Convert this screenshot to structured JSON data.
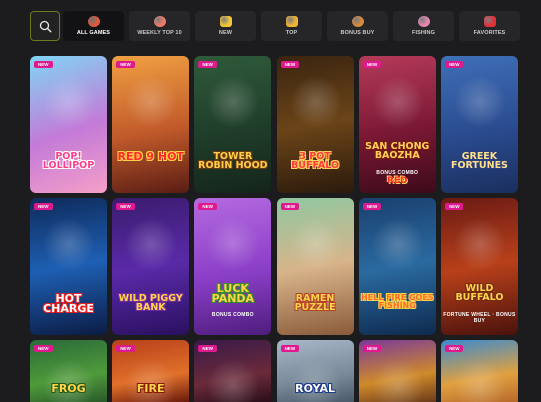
{
  "tabs": [
    {
      "label": "ALL GAMES",
      "icon": "slot-icon",
      "color": "#e0583a",
      "active": true
    },
    {
      "label": "WEEKLY TOP 10",
      "icon": "hot-icon",
      "color": "#f07a6a",
      "active": false
    },
    {
      "label": "NEW",
      "icon": "star-icon",
      "color": "#f4c534",
      "active": false
    },
    {
      "label": "TOP",
      "icon": "crown-icon",
      "color": "#f2b233",
      "active": false
    },
    {
      "label": "BONUS BUY",
      "icon": "money-bag-icon",
      "color": "#d98a3a",
      "active": false
    },
    {
      "label": "FISHING",
      "icon": "shell-icon",
      "color": "#e986b2",
      "active": false
    },
    {
      "label": "FAVORITES",
      "icon": "heart-icon",
      "color": "#e2303a",
      "active": false
    }
  ],
  "badge_label": "NEW",
  "games": [
    {
      "title": "POP! LOLLIPOP",
      "bg": "linear-gradient(160deg,#7fd6f4 0%,#c47ad8 55%,#f59fc8 100%)",
      "title_color": "#ff3e8a",
      "stroke": "#fff"
    },
    {
      "title": "RED 9 HOT",
      "bg": "linear-gradient(170deg,#f0a043 0%,#c15a2a 55%,#5a1d14 100%)",
      "title_color": "#ff2b2b",
      "stroke": "#ffd04a"
    },
    {
      "title": "TOWER ROBIN HOOD",
      "bg": "linear-gradient(170deg,#2f5a3a 0%,#1f3d2a 55%,#14251a 100%)",
      "title_color": "#ffcf48",
      "stroke": "#6a3a10"
    },
    {
      "title": "3 POT BUFFALO",
      "bg": "linear-gradient(170deg,#3a2410 0%,#6b4418 50%,#2b1a0c 100%)",
      "title_color": "#ff3b3b",
      "stroke": "#ffd35a"
    },
    {
      "title": "SAN CHONG BAOZHA",
      "subtitle": "BONUS COMBO",
      "extra": "RED",
      "bg": "linear-gradient(170deg,#b53a5a 0%,#7a1834 55%,#3c0a1a 100%)",
      "title_color": "#ffd25a",
      "stroke": "#7a1a10"
    },
    {
      "title": "GREEK FORTUNES",
      "bg": "linear-gradient(170deg,#3f6fb8 0%,#2a4b8f 55%,#1a2f5e 100%)",
      "title_color": "#ffe08a",
      "stroke": "#2a3f80"
    },
    {
      "title": "HOT CHARGE",
      "bg": "linear-gradient(170deg,#0e2a5a 0%,#1e5fb3 50%,#0b1c44 100%)",
      "title_color": "#ffffff",
      "stroke": "#e22"
    },
    {
      "title": "WILD PIGGY BANK",
      "bg": "linear-gradient(170deg,#3a1c6e 0%,#5a2aa8 50%,#2a1060 100%)",
      "title_color": "#ffd54a",
      "stroke": "#7a2aa0"
    },
    {
      "title": "LUCK PANDA",
      "subtitle": "BONUS COMBO",
      "bg": "linear-gradient(170deg,#b46adf 0%,#8b3fc8 55%,#4e1d7d 100%)",
      "title_color": "#ffd54a",
      "stroke": "#3a8f2a"
    },
    {
      "title": "RAMEN PUZZLE",
      "bg": "linear-gradient(170deg,#8fc8a0 0%,#d8b48a 50%,#8a5a3a 100%)",
      "title_color": "#ffd54a",
      "stroke": "#b8402a"
    },
    {
      "title": "HELL FIRE GOES FISHING",
      "bg": "linear-gradient(170deg,#1a3f6e 0%,#2a6aa0 50%,#0e2a4e 100%)",
      "title_color": "#ff6a2a",
      "stroke": "#ffd54a"
    },
    {
      "title": "WILD BUFFALO",
      "subtitle": "FORTUNE WHEEL · BONUS BUY",
      "bg": "linear-gradient(170deg,#6a1a14 0%,#b8401a 50%,#4a120c 100%)",
      "title_color": "#ffd54a",
      "stroke": "#7a2a10"
    },
    {
      "title": "FROG",
      "bg": "linear-gradient(170deg,#2a6a3a 0%,#4f9a3a 60%,#2a5a2a 100%)",
      "title_color": "#ffd54a",
      "stroke": "#2a5a1a"
    },
    {
      "title": "FIRE",
      "bg": "linear-gradient(170deg,#b8401a 0%,#e0702a 60%,#6a1a0c 100%)",
      "title_color": "#ffd54a",
      "stroke": "#8a1a0a"
    },
    {
      "title": "",
      "bg": "linear-gradient(170deg,#3a1a4a 0%,#6a2a3a 60%,#2a0e1a 100%)",
      "title_color": "#ffd54a",
      "stroke": "#000"
    },
    {
      "title": "ROYAL",
      "bg": "linear-gradient(170deg,#a8b8c8 0%,#7a8a9a 60%,#4a5a6a 100%)",
      "title_color": "#ffffff",
      "stroke": "#1a3a8a"
    },
    {
      "title": "",
      "bg": "linear-gradient(170deg,#7a3a9a 0%,#d08a2a 60%,#6a3a1a 100%)",
      "title_color": "#ffd54a",
      "stroke": "#000"
    },
    {
      "title": "",
      "bg": "linear-gradient(170deg,#3a8ad0 0%,#e0a040 60%,#b86a2a 100%)",
      "title_color": "#ffd54a",
      "stroke": "#000"
    }
  ]
}
